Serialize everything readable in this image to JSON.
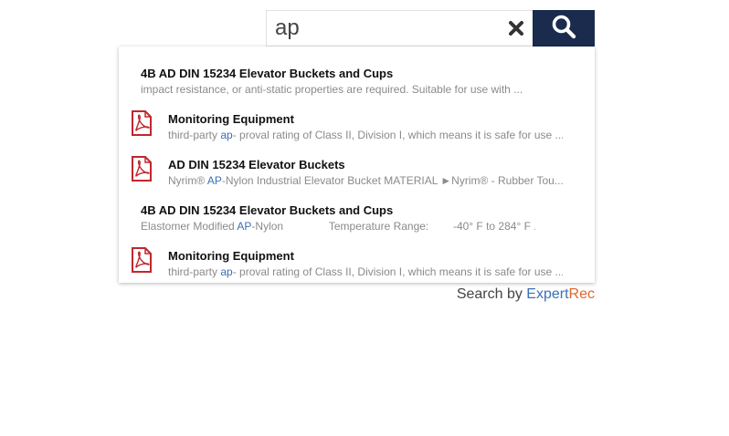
{
  "search": {
    "query": "ap"
  },
  "results": [
    {
      "title": "4B AD DIN 15234 Elevator Buckets and Cups",
      "snippet_pre": "impact resistance, or anti-static properties are required.  Suitable for use with ...",
      "snippet_hl": "",
      "snippet_post": "",
      "has_pdf": false
    },
    {
      "title": "Monitoring Equipment",
      "snippet_pre": "third-party ",
      "snippet_hl": "ap",
      "snippet_post": "- proval rating of Class II, Division I, which means it is safe for use ...",
      "has_pdf": true
    },
    {
      "title": "AD DIN 15234 Elevator Buckets",
      "snippet_pre": "Nyrim® ",
      "snippet_hl": "AP",
      "snippet_post": "-Nylon Industrial Elevator Bucket MATERIAL ►Nyrim® - Rubber Tou...",
      "has_pdf": true
    },
    {
      "title": "4B AD DIN 15234 Elevator Buckets and Cups",
      "snippet_pre": "Elastomer Modified ",
      "snippet_hl": "AP",
      "snippet_post": "-Nylon               Temperature Range:        -40° F to 284° F ...",
      "has_pdf": false
    },
    {
      "title": "Monitoring Equipment",
      "snippet_pre": "third-party ",
      "snippet_hl": "ap",
      "snippet_post": "- proval rating of Class II, Division I, which means it is safe for use ...",
      "has_pdf": true
    }
  ],
  "footer": {
    "prefix": "Search by ",
    "brand_part1": "Expert",
    "brand_part2": "Rec"
  },
  "colors": {
    "search_button_bg": "#1a2b4e",
    "highlight": "#3b6fb6",
    "brand_orange": "#e0662a",
    "pdf_red": "#c0272d"
  },
  "icons": {
    "clear": "close-icon",
    "search": "magnifier-icon",
    "pdf": "pdf-file-icon"
  }
}
